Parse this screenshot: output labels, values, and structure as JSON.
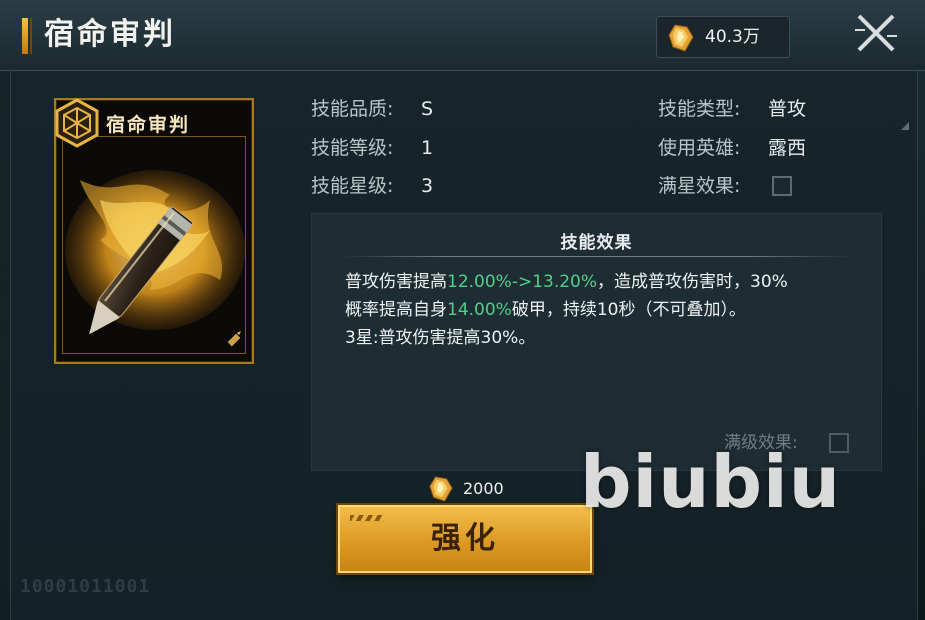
{
  "header": {
    "title": "宿命审判",
    "currency_value": "40.3万",
    "currency_icon": "gold-crystal-icon",
    "close_icon": "close-icon"
  },
  "card": {
    "name": "宿命审判",
    "emblem_icon": "hexagon-emblem-icon",
    "art_icon": "flaming-bullet-icon",
    "corner_icon": "bullet-icon"
  },
  "info": {
    "quality_label": "技能品质:",
    "quality_value": "S",
    "level_label": "技能等级:",
    "level_value": "1",
    "star_label": "技能星级:",
    "star_value": "3",
    "type_label": "技能类型:",
    "type_value": "普攻",
    "hero_label": "使用英雄:",
    "hero_value": "露西",
    "max_star_label": "满星效果:"
  },
  "effect": {
    "title": "技能效果",
    "line1_a": "普攻伤害提高",
    "line1_b": "12.00%->13.20%",
    "line1_c": "，造成普攻伤害时，30%",
    "line2_a": "概率提高自身",
    "line2_b": "14.00%",
    "line2_c": "破甲，持续10秒（不可叠加）。",
    "line3": "3星:普攻伤害提高30%。",
    "max_level_label": "满级效果:"
  },
  "upgrade": {
    "cost": "2000",
    "button_label": "强化"
  },
  "watermark": "biubiu",
  "corner_id": "10001011001",
  "colors": {
    "gold": "#dc9a24",
    "highlight_green": "#4fd08a",
    "panel": "#1e2d33"
  }
}
